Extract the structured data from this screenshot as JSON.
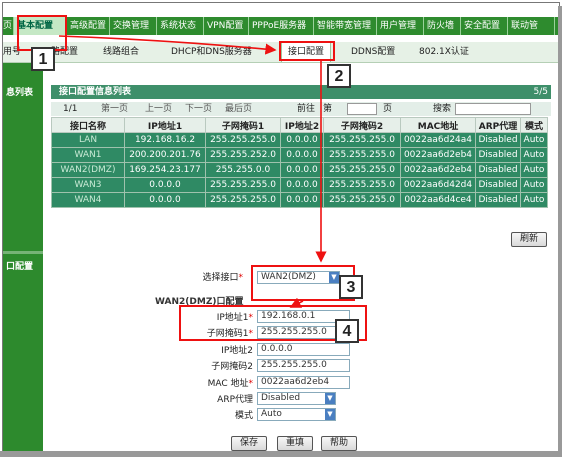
{
  "nav": {
    "tabs": [
      "页",
      "基本配置",
      "高级配置",
      "交换管理",
      "系统状态",
      "VPN配置",
      "PPPoE服务器",
      "智能带宽管理",
      "用户管理",
      "防火墙",
      "安全配置",
      "联动管"
    ],
    "subtabs": [
      "用号",
      "路配置",
      "线路组合",
      "DHCP和DNS服务器",
      "接口配置",
      "DDNS配置",
      "802.1X认证"
    ]
  },
  "left": {
    "info_label": "息列表",
    "config_label": "口配置"
  },
  "panel": {
    "title": "接口配置信息列表",
    "page_count": "5/5",
    "pager": {
      "current": "1/1",
      "first": "第一页",
      "prev": "上一页",
      "next": "下一页",
      "last": "最后页",
      "goto": "前往",
      "di": "第",
      "ye": "页",
      "search": "搜索"
    }
  },
  "table": {
    "headers": [
      "接口名称",
      "IP地址1",
      "子网掩码1",
      "IP地址2",
      "子网掩码2",
      "MAC地址",
      "ARP代理",
      "模式"
    ],
    "rows": [
      [
        "LAN",
        "192.168.16.2",
        "255.255.255.0",
        "0.0.0.0",
        "255.255.255.0",
        "0022aa6d24a4",
        "Disabled",
        "Auto"
      ],
      [
        "WAN1",
        "200.200.201.76",
        "255.255.252.0",
        "0.0.0.0",
        "255.255.255.0",
        "0022aa6d2eb4",
        "Disabled",
        "Auto"
      ],
      [
        "WAN2(DMZ)",
        "169.254.23.177",
        "255.255.0.0",
        "0.0.0.0",
        "255.255.255.0",
        "0022aa6d2eb4",
        "Disabled",
        "Auto"
      ],
      [
        "WAN3",
        "0.0.0.0",
        "255.255.255.0",
        "0.0.0.0",
        "255.255.255.0",
        "0022aa6d42d4",
        "Disabled",
        "Auto"
      ],
      [
        "WAN4",
        "0.0.0.0",
        "255.255.255.0",
        "0.0.0.0",
        "255.255.255.0",
        "0022aa6d4ce4",
        "Disabled",
        "Auto"
      ]
    ],
    "refresh_label": "刷新"
  },
  "form": {
    "select_label": "选择接口",
    "select_value": "WAN2(DMZ)",
    "section_title": "WAN2(DMZ)口配置",
    "fields": [
      {
        "label": "IP地址1",
        "value": "192.168.0.1",
        "required": "*"
      },
      {
        "label": "子网掩码1",
        "value": "255.255.255.0",
        "required": "*"
      },
      {
        "label": "IP地址2",
        "value": "0.0.0.0",
        "required": ""
      },
      {
        "label": "子网掩码2",
        "value": "255.255.255.0",
        "required": ""
      },
      {
        "label": "MAC 地址",
        "value": "0022aa6d2eb4",
        "required": "*"
      }
    ],
    "arp_label": "ARP代理",
    "arp_value": "Disabled",
    "mode_label": "模式",
    "mode_value": "Auto",
    "buttons": {
      "save": "保存",
      "reset": "重填",
      "help": "帮助"
    }
  },
  "annotations": [
    "1",
    "2",
    "3",
    "4"
  ],
  "colors": {
    "nav_green": "#2e8b2e",
    "table_green": "#2f8a64",
    "annotation_red": "#e11111"
  }
}
